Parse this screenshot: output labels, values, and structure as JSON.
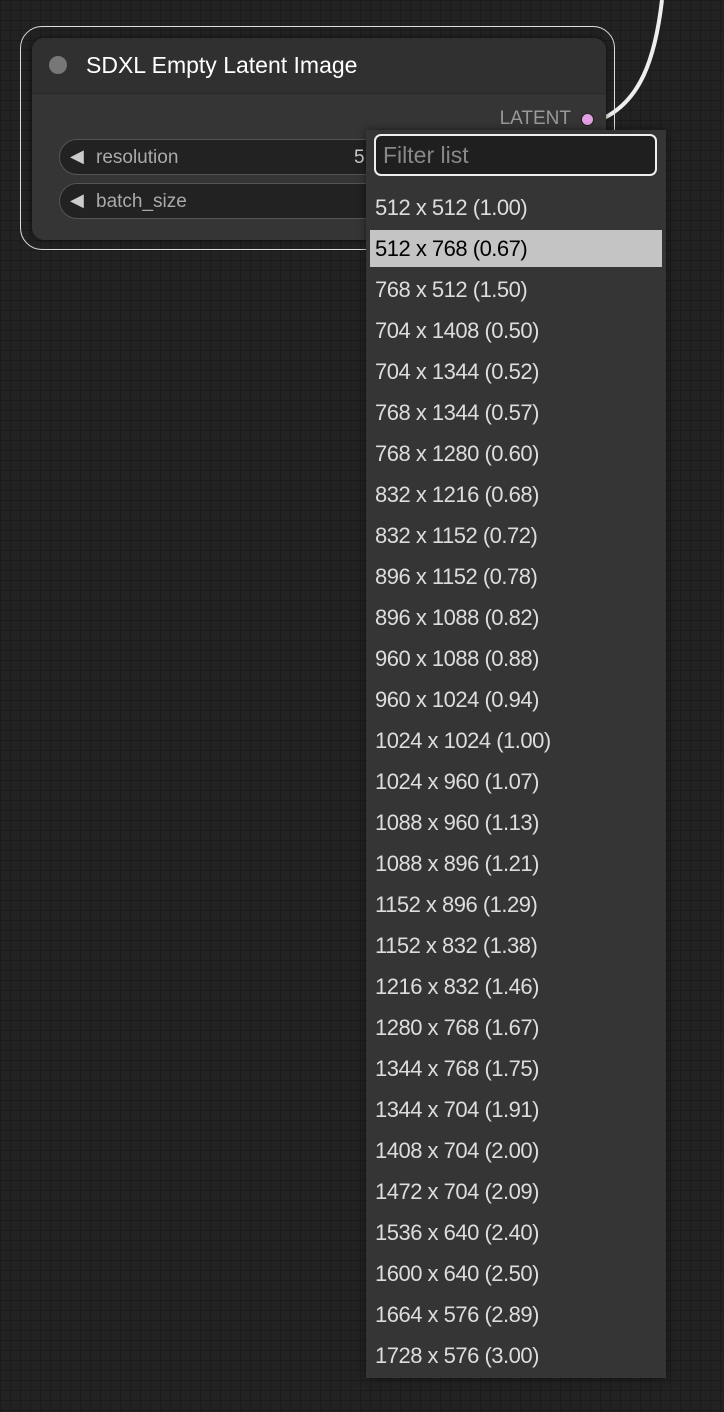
{
  "node": {
    "title": "SDXL Empty Latent Image",
    "output_label": "LATENT",
    "widgets": [
      {
        "label": "resolution",
        "value": "5"
      },
      {
        "label": "batch_size",
        "value": ""
      }
    ]
  },
  "menu": {
    "filter_placeholder": "Filter list",
    "highlighted_index": 1,
    "items": [
      "512 x 512 (1.00)",
      "512 x 768 (0.67)",
      "768 x 512 (1.50)",
      "704 x 1408 (0.50)",
      "704 x 1344 (0.52)",
      "768 x 1344 (0.57)",
      "768 x 1280 (0.60)",
      "832 x 1216 (0.68)",
      "832 x 1152 (0.72)",
      "896 x 1152 (0.78)",
      "896 x 1088 (0.82)",
      "960 x 1088 (0.88)",
      "960 x 1024 (0.94)",
      "1024 x 1024 (1.00)",
      "1024 x 960 (1.07)",
      "1088 x 960 (1.13)",
      "1088 x 896 (1.21)",
      "1152 x 896 (1.29)",
      "1152 x 832 (1.38)",
      "1216 x 832 (1.46)",
      "1280 x 768 (1.67)",
      "1344 x 768 (1.75)",
      "1344 x 704 (1.91)",
      "1408 x 704 (2.00)",
      "1472 x 704 (2.09)",
      "1536 x 640 (2.40)",
      "1600 x 640 (2.50)",
      "1664 x 576 (2.89)",
      "1728 x 576 (3.00)"
    ]
  },
  "colors": {
    "latent_pin": "#e39fe3",
    "highlight": "#c4c4c4"
  }
}
